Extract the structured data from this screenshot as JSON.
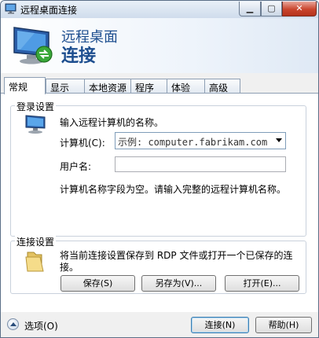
{
  "window": {
    "title": "远程桌面连接"
  },
  "banner": {
    "title": "远程桌面",
    "subtitle": "连接"
  },
  "tabs": [
    {
      "label": "常规",
      "active": true
    },
    {
      "label": "显示",
      "active": false
    },
    {
      "label": "本地资源",
      "active": false
    },
    {
      "label": "程序",
      "active": false
    },
    {
      "label": "体验",
      "active": false
    },
    {
      "label": "高级",
      "active": false
    }
  ],
  "login": {
    "group_title": "登录设置",
    "prompt": "输入远程计算机的名称。",
    "computer_label": "计算机(C):",
    "computer_value": "示例: computer.fabrikam.com",
    "username_label": "用户名:",
    "username_value": "",
    "hint": "计算机名称字段为空。请输入完整的远程计算机名称。"
  },
  "connection": {
    "group_title": "连接设置",
    "description_line1": "将当前连接设置保存到 RDP 文件或打开一个已保存的连",
    "description_line2": "接。",
    "save_label": "保存(S)",
    "save_as_label": "另存为(V)...",
    "open_label": "打开(E)..."
  },
  "footer": {
    "options_label": "选项(O)",
    "connect_label": "连接(N)",
    "help_label": "帮助(H)"
  }
}
